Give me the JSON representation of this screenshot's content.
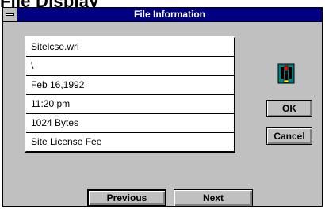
{
  "page": {
    "heading": "File Display"
  },
  "window": {
    "title": "File Information"
  },
  "fields": [
    {
      "name": "field-filename",
      "value": "Sitelcse.wri"
    },
    {
      "name": "field-path",
      "value": "\\"
    },
    {
      "name": "field-date",
      "value": "Feb 16,1992"
    },
    {
      "name": "field-time",
      "value": "11:20 pm"
    },
    {
      "name": "field-size",
      "value": "1024 Bytes"
    },
    {
      "name": "field-description",
      "value": "Site License Fee"
    }
  ],
  "buttons": {
    "ok": "OK",
    "cancel": "Cancel",
    "previous": "Previous",
    "next": "Next"
  },
  "icons": {
    "file_icon": "file-info-icon",
    "system_menu": "system-menu-icon"
  },
  "colors": {
    "titlebar": "#000080",
    "dialog_face": "#c0c0c0",
    "field_background": "#ffffff",
    "icon_accent": "#008080"
  }
}
